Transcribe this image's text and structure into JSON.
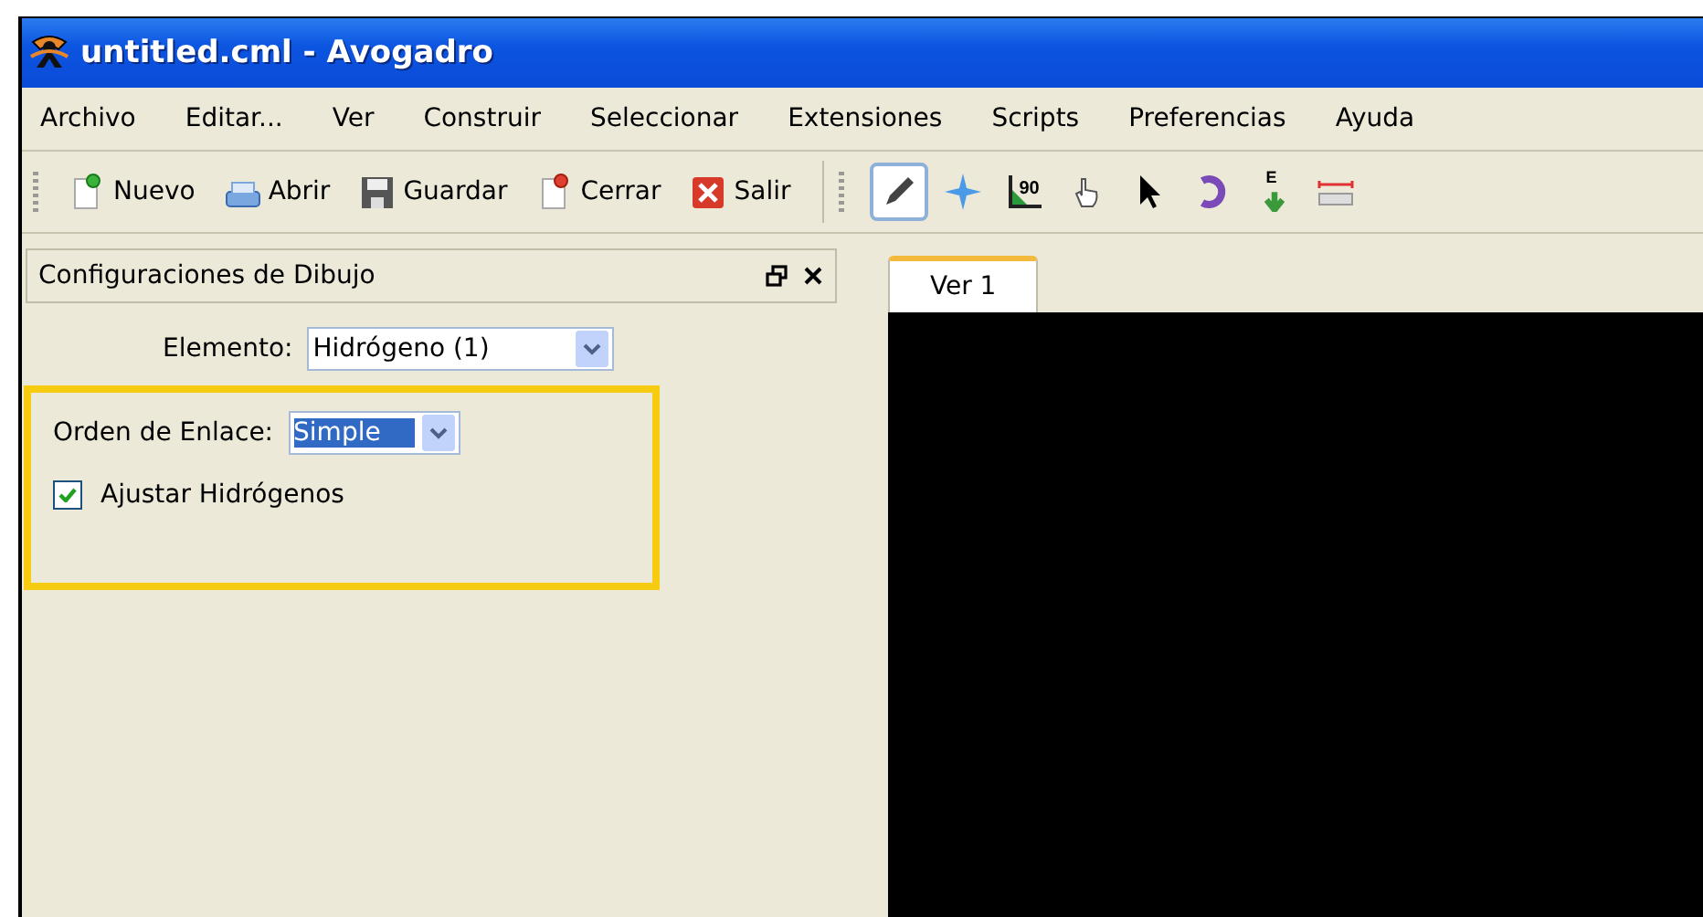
{
  "window": {
    "title": "untitled.cml - Avogadro"
  },
  "menu": [
    "Archivo",
    "Editar...",
    "Ver",
    "Construir",
    "Seleccionar",
    "Extensiones",
    "Scripts",
    "Preferencias",
    "Ayuda"
  ],
  "toolbar": [
    {
      "kind": "new",
      "label": "Nuevo"
    },
    {
      "kind": "open",
      "label": "Abrir"
    },
    {
      "kind": "save",
      "label": "Guardar"
    },
    {
      "kind": "close",
      "label": "Cerrar"
    },
    {
      "kind": "quit",
      "label": "Salir"
    }
  ],
  "tools": [
    {
      "kind": "draw",
      "selected": true
    },
    {
      "kind": "navigate",
      "selected": false
    },
    {
      "kind": "measure",
      "glyph": "90",
      "selected": false
    },
    {
      "kind": "manipulate",
      "selected": false
    },
    {
      "kind": "select",
      "selected": false
    },
    {
      "kind": "rotate",
      "selected": false
    },
    {
      "kind": "optimize",
      "glyph": "E",
      "selected": false
    },
    {
      "kind": "ruler",
      "selected": false
    }
  ],
  "dock": {
    "title": "Configuraciones de Dibujo",
    "element": {
      "label": "Elemento:",
      "value": "Hidrógeno (1)"
    },
    "highlighted": true,
    "bond_order": {
      "label": "Orden de Enlace:",
      "value": "Simple"
    },
    "adjust_hydrogens": {
      "label": "Ajustar Hidrógenos",
      "checked": true
    }
  },
  "view_tabs": [
    {
      "label": "Ver 1",
      "selected": true
    }
  ]
}
